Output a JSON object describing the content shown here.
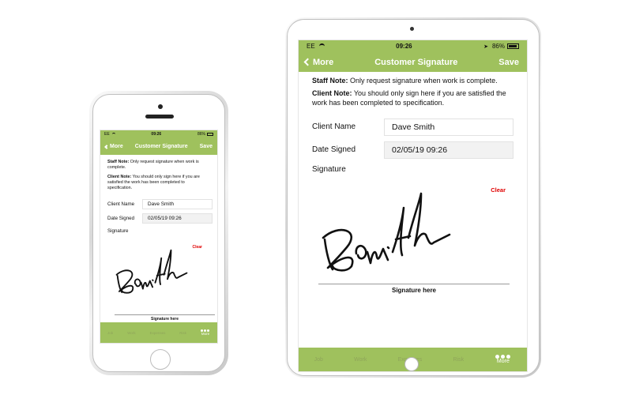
{
  "status_bar": {
    "carrier": "EE",
    "time": "09:26",
    "battery": "86%"
  },
  "navbar": {
    "back_label": "More",
    "title": "Customer Signature",
    "save_label": "Save"
  },
  "notes": {
    "staff_label": "Staff Note:",
    "staff_text": "Only request signature when work is complete.",
    "client_label": "Client Note:",
    "client_text": "You should only sign here if you are satisfied the work has been completed to specification."
  },
  "form": {
    "client_name_label": "Client Name",
    "client_name_value": "Dave Smith",
    "date_signed_label": "Date Signed",
    "date_signed_value": "02/05/19 09:26",
    "signature_label": "Signature"
  },
  "signature": {
    "clear_label": "Clear",
    "caption": "Signature here"
  },
  "tabs": [
    {
      "label": "Job"
    },
    {
      "label": "Work"
    },
    {
      "label": "Expenses"
    },
    {
      "label": "Risk"
    },
    {
      "label": "More"
    }
  ],
  "colors": {
    "accent": "#9fc15d",
    "clear": "#e00000"
  }
}
